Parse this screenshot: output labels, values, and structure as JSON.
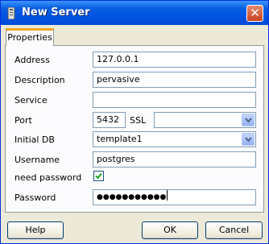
{
  "window": {
    "title": "New Server"
  },
  "tabs": [
    {
      "label": "Properties"
    }
  ],
  "form": {
    "address": {
      "label": "Address",
      "value": "127.0.0.1"
    },
    "description": {
      "label": "Description",
      "value": "pervasive"
    },
    "service": {
      "label": "Service",
      "value": ""
    },
    "port": {
      "label": "Port",
      "value": "5432"
    },
    "ssl": {
      "label": "SSL",
      "value": ""
    },
    "initial_db": {
      "label": "Initial DB",
      "value": "template1"
    },
    "username": {
      "label": "Username",
      "value": "postgres"
    },
    "need_password": {
      "label": "need password",
      "checked": true
    },
    "password": {
      "label": "Password",
      "value": "●●●●●●●●●●●"
    }
  },
  "buttons": {
    "help": "Help",
    "ok": "OK",
    "cancel": "Cancel"
  },
  "icons": {
    "app": "app-icon",
    "close": "close-icon",
    "dropdown": "chevron-down-icon",
    "check": "check-icon"
  },
  "colors": {
    "titlebar": "#0054e3",
    "tab_highlight": "#f5a623",
    "checkmark": "#21a121",
    "field_border": "#7f9db9"
  }
}
